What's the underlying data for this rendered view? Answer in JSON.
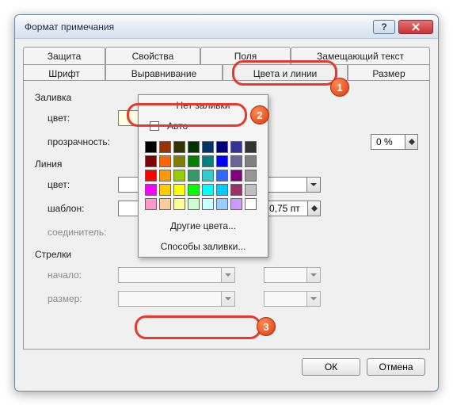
{
  "window": {
    "title": "Формат примечания"
  },
  "tabs": {
    "row1": [
      "Защита",
      "Свойства",
      "Поля",
      "Замещающий текст"
    ],
    "row2": [
      "Шрифт",
      "Выравнивание",
      "Цвета и линии",
      "Размер"
    ],
    "active": "Цвета и линии"
  },
  "fill": {
    "group": "Заливка",
    "color_label": "цвет:",
    "transparency_label": "прозрачность:",
    "transparency_value": "0 %"
  },
  "line": {
    "group": "Линия",
    "color_label": "цвет:",
    "pattern_label": "шаблон:",
    "connector_label": "соединитель:",
    "weight_value": "0,75 пт"
  },
  "arrows": {
    "group": "Стрелки",
    "begin_label": "начало:",
    "size_label": "размер:"
  },
  "popup": {
    "no_fill": "Нет заливки",
    "auto": "Авто",
    "more_colors": "Другие цвета...",
    "fill_effects": "Способы заливки..."
  },
  "buttons": {
    "ok": "ОК",
    "cancel": "Отмена"
  },
  "badges": {
    "b1": "1",
    "b2": "2",
    "b3": "3"
  },
  "swatches": [
    [
      "#000000",
      "#993300",
      "#333300",
      "#003300",
      "#003366",
      "#000080",
      "#333399",
      "#333333"
    ],
    [
      "#800000",
      "#ff6600",
      "#808000",
      "#008000",
      "#008080",
      "#0000ff",
      "#666699",
      "#808080"
    ],
    [
      "#ff0000",
      "#ff9900",
      "#99cc00",
      "#339966",
      "#33cccc",
      "#3366ff",
      "#800080",
      "#969696"
    ],
    [
      "#ff00ff",
      "#ffcc00",
      "#ffff00",
      "#00ff00",
      "#00ffff",
      "#00ccff",
      "#993366",
      "#c0c0c0"
    ],
    [
      "#ff99cc",
      "#ffcc99",
      "#ffff99",
      "#ccffcc",
      "#ccffff",
      "#99ccff",
      "#cc99ff",
      "#ffffff"
    ]
  ]
}
